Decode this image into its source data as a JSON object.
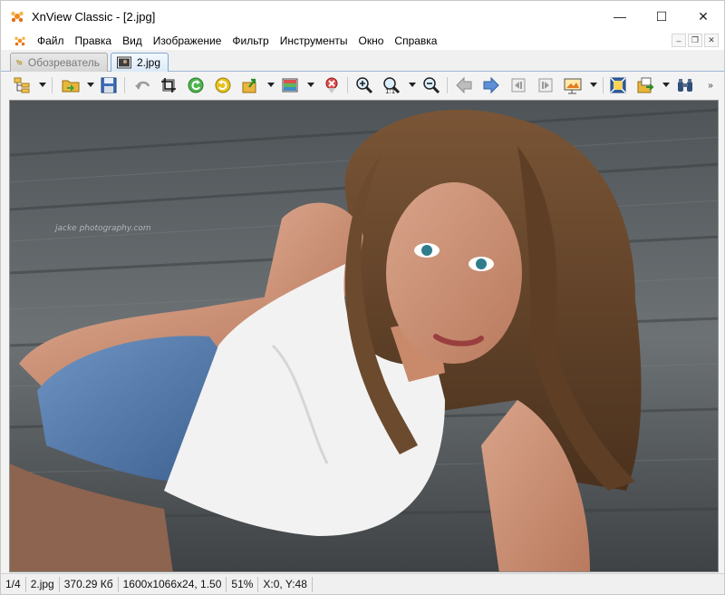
{
  "window": {
    "title": "XnView Classic - [2.jpg]",
    "controls": {
      "minimize": "—",
      "maximize": "☐",
      "close": "✕"
    }
  },
  "menu": {
    "items": [
      "Файл",
      "Правка",
      "Вид",
      "Изображение",
      "Фильтр",
      "Инструменты",
      "Окно",
      "Справка"
    ],
    "mdi": {
      "minimize": "–",
      "restore": "❐",
      "close": "✕"
    }
  },
  "tabs": [
    {
      "label": "Обозреватель",
      "active": false
    },
    {
      "label": "2.jpg",
      "active": true
    }
  ],
  "toolbar": {
    "buttons": [
      "folders-tree-icon",
      "open-folder-icon",
      "save-icon",
      "undo-icon",
      "crop-icon",
      "rotate-left-icon",
      "rotate-right-icon",
      "export-icon",
      "adjust-colors-icon",
      "properties-icon",
      "zoom-in-icon",
      "zoom-actual-icon",
      "zoom-out-icon",
      "prev-icon",
      "next-icon",
      "first-icon",
      "last-icon",
      "slideshow-icon",
      "fit-window-icon",
      "copy-to-icon",
      "binoculars-icon"
    ]
  },
  "photo": {
    "watermark": "jacke photography.com"
  },
  "status": {
    "position": "1/4",
    "filename": "2.jpg",
    "filesize": "370.29 Кб",
    "dimensions": "1600x1066x24, 1.50",
    "zoom": "51%",
    "cursor": "X:0, Y:48"
  },
  "colors": {
    "accent": "#7fa6cf",
    "toolbar_bg": "#f3f3f3"
  }
}
